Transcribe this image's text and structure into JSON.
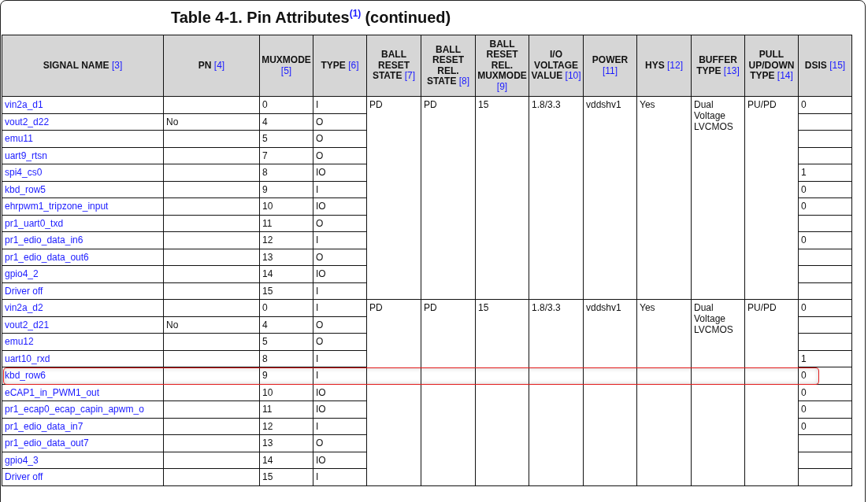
{
  "title": {
    "text": "Table 4-1. Pin Attributes",
    "note": "(1)",
    "suffix": "(continued)"
  },
  "columns": [
    {
      "label": "SIGNAL NAME",
      "ref": "[3]"
    },
    {
      "label": "PN",
      "ref": "[4]"
    },
    {
      "label": "MUXMODE",
      "ref": "[5]"
    },
    {
      "label": "TYPE",
      "ref": "[6]"
    },
    {
      "label": "BALL RESET STATE",
      "ref": "[7]"
    },
    {
      "label": "BALL RESET REL. STATE",
      "ref": "[8]"
    },
    {
      "label": "BALL RESET REL. MUXMODE",
      "ref": "[9]"
    },
    {
      "label": "I/O VOLTAGE VALUE",
      "ref": "[10]"
    },
    {
      "label": "POWER",
      "ref": "[11]"
    },
    {
      "label": "HYS",
      "ref": "[12]"
    },
    {
      "label": "BUFFER TYPE",
      "ref": "[13]"
    },
    {
      "label": "PULL UP/DOWN TYPE",
      "ref": "[14]"
    },
    {
      "label": "DSIS",
      "ref": "[15]"
    }
  ],
  "groups": [
    {
      "ball_reset_state": "PD",
      "ball_reset_rel_state": "PD",
      "ball_reset_rel_muxmode": "15",
      "io_voltage": "1.8/3.3",
      "power": "vddshv1",
      "hys": "Yes",
      "buffer_type": "Dual Voltage LVCMOS",
      "pull_type": "PU/PD",
      "rows": [
        {
          "signal": "vin2a_d1",
          "pn": "",
          "muxmode": "0",
          "type": "I",
          "dsis": "0",
          "highlighted": false
        },
        {
          "signal": "vout2_d22",
          "pn": "No",
          "muxmode": "4",
          "type": "O",
          "dsis": "",
          "highlighted": false
        },
        {
          "signal": "emu11",
          "pn": "",
          "muxmode": "5",
          "type": "O",
          "dsis": "",
          "highlighted": false
        },
        {
          "signal": "uart9_rtsn",
          "pn": "",
          "muxmode": "7",
          "type": "O",
          "dsis": "",
          "highlighted": false
        },
        {
          "signal": "spi4_cs0",
          "pn": "",
          "muxmode": "8",
          "type": "IO",
          "dsis": "1",
          "highlighted": false
        },
        {
          "signal": "kbd_row5",
          "pn": "",
          "muxmode": "9",
          "type": "I",
          "dsis": "0",
          "highlighted": false
        },
        {
          "signal": "ehrpwm1_tripzone_input",
          "pn": "",
          "muxmode": "10",
          "type": "IO",
          "dsis": "0",
          "highlighted": false
        },
        {
          "signal": "pr1_uart0_txd",
          "pn": "",
          "muxmode": "11",
          "type": "O",
          "dsis": "",
          "highlighted": false
        },
        {
          "signal": "pr1_edio_data_in6",
          "pn": "",
          "muxmode": "12",
          "type": "I",
          "dsis": "0",
          "highlighted": false
        },
        {
          "signal": "pr1_edio_data_out6",
          "pn": "",
          "muxmode": "13",
          "type": "O",
          "dsis": "",
          "highlighted": false
        },
        {
          "signal": "gpio4_2",
          "pn": "",
          "muxmode": "14",
          "type": "IO",
          "dsis": "",
          "highlighted": false
        },
        {
          "signal": "Driver off",
          "pn": "",
          "muxmode": "15",
          "type": "I",
          "dsis": "",
          "highlighted": false
        }
      ]
    },
    {
      "ball_reset_state": "PD",
      "ball_reset_rel_state": "PD",
      "ball_reset_rel_muxmode": "15",
      "io_voltage": "1.8/3.3",
      "power": "vddshv1",
      "hys": "Yes",
      "buffer_type": "Dual Voltage LVCMOS",
      "pull_type": "PU/PD",
      "rows": [
        {
          "signal": "vin2a_d2",
          "pn": "",
          "muxmode": "0",
          "type": "I",
          "dsis": "0",
          "highlighted": false
        },
        {
          "signal": "vout2_d21",
          "pn": "No",
          "muxmode": "4",
          "type": "O",
          "dsis": "",
          "highlighted": false
        },
        {
          "signal": "emu12",
          "pn": "",
          "muxmode": "5",
          "type": "O",
          "dsis": "",
          "highlighted": false
        },
        {
          "signal": "uart10_rxd",
          "pn": "",
          "muxmode": "8",
          "type": "I",
          "dsis": "1",
          "highlighted": false
        },
        {
          "signal": "kbd_row6",
          "pn": "",
          "muxmode": "9",
          "type": "I",
          "dsis": "0",
          "highlighted": true
        },
        {
          "signal": "eCAP1_in_PWM1_out",
          "pn": "",
          "muxmode": "10",
          "type": "IO",
          "dsis": "0",
          "highlighted": false
        },
        {
          "signal": "pr1_ecap0_ecap_capin_apwm_o",
          "pn": "",
          "muxmode": "11",
          "type": "IO",
          "dsis": "0",
          "highlighted": false
        },
        {
          "signal": "pr1_edio_data_in7",
          "pn": "",
          "muxmode": "12",
          "type": "I",
          "dsis": "0",
          "highlighted": false
        },
        {
          "signal": "pr1_edio_data_out7",
          "pn": "",
          "muxmode": "13",
          "type": "O",
          "dsis": "",
          "highlighted": false
        },
        {
          "signal": "gpio4_3",
          "pn": "",
          "muxmode": "14",
          "type": "IO",
          "dsis": "",
          "highlighted": false
        },
        {
          "signal": "Driver off",
          "pn": "",
          "muxmode": "15",
          "type": "I",
          "dsis": "",
          "highlighted": false
        }
      ]
    }
  ]
}
